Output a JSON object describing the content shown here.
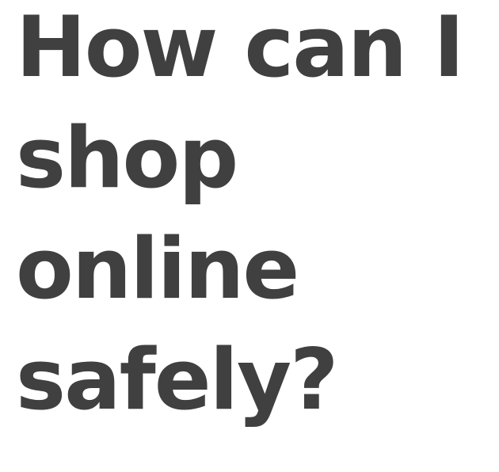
{
  "headline": {
    "lines": [
      "How can I",
      "shop",
      "online",
      "safely?"
    ]
  },
  "colors": {
    "text": "#404040",
    "background": "#ffffff"
  }
}
